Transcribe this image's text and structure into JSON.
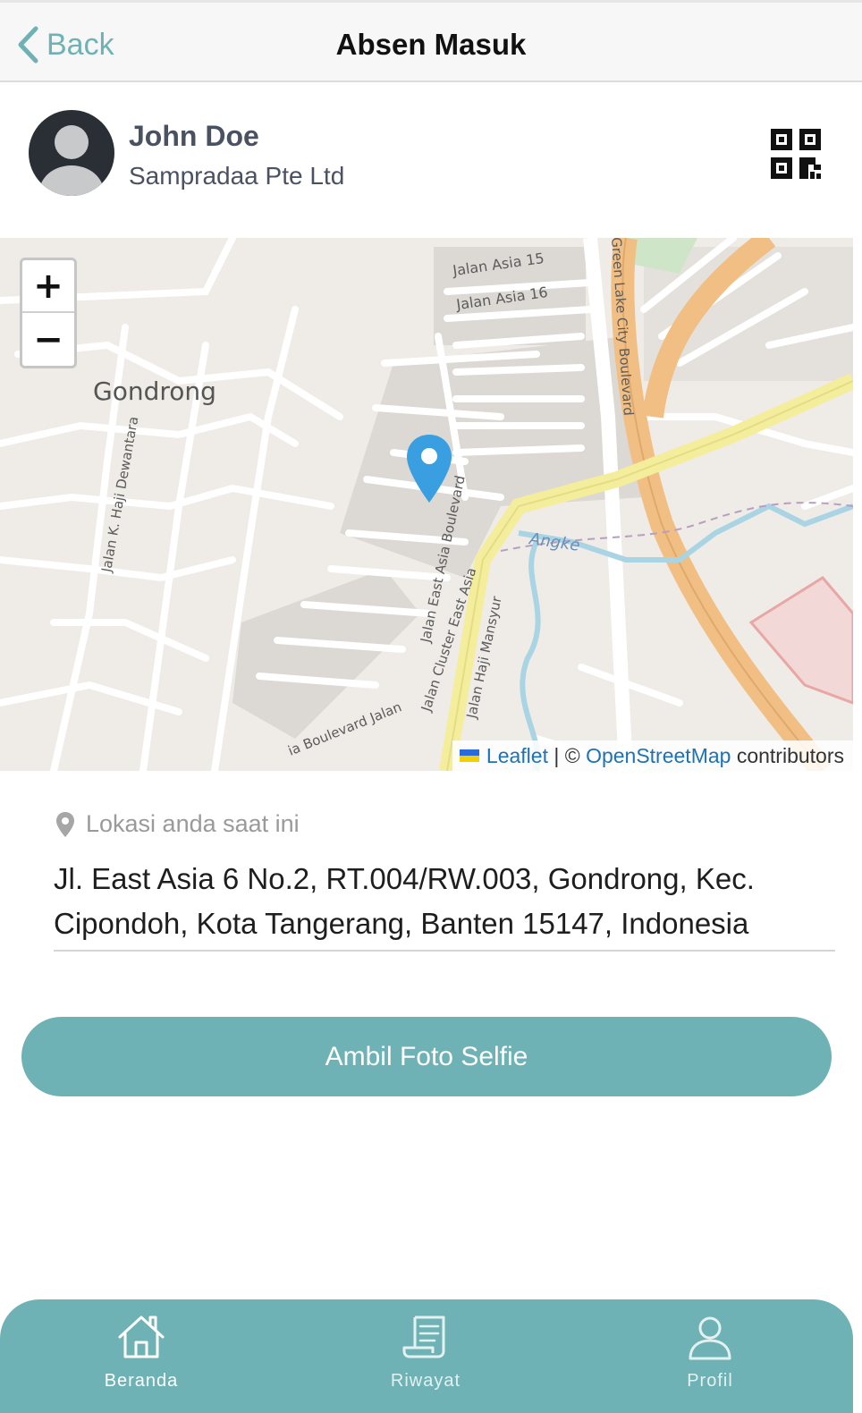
{
  "header": {
    "back_label": "Back",
    "title": "Absen Masuk"
  },
  "profile": {
    "name": "John Doe",
    "company": "Sampradaa Pte Ltd",
    "qr_icon": "qr-code-icon"
  },
  "map": {
    "zoom_in": "+",
    "zoom_out": "−",
    "labels": {
      "area": "Gondrong",
      "road_1": "Jalan K. Haji Dewantara",
      "road_2": "Jalan Asia 15",
      "road_3": "Jalan Asia 16",
      "road_4": "Jalan East Asia Boulevard",
      "road_5": "Jalan Cluster East Asia",
      "road_6": "Jalan Haji Mansyur",
      "road_7": "Green Lake City Boulevard",
      "river": "Angke",
      "road_8": "ia Boulevard  Jalan"
    },
    "attribution": {
      "leaflet": "Leaflet",
      "separator": " | © ",
      "osm": "OpenStreetMap",
      "suffix": " contributors"
    }
  },
  "location": {
    "label": "Lokasi anda saat ini",
    "address": "Jl. East Asia 6 No.2, RT.004/RW.003, Gondrong, Kec. Cipondoh, Kota Tangerang, Banten 15147, Indonesia"
  },
  "actions": {
    "selfie_label": "Ambil Foto Selfie"
  },
  "bottom_nav": {
    "items": [
      {
        "label": "Beranda",
        "icon": "home-icon",
        "active": true
      },
      {
        "label": "Riwayat",
        "icon": "receipt-icon",
        "active": false
      },
      {
        "label": "Profil",
        "icon": "user-icon",
        "active": false
      }
    ]
  },
  "colors": {
    "accent": "#6fb2b6",
    "header_bg": "#f7f7f7",
    "pin": "#3a9fe0"
  }
}
